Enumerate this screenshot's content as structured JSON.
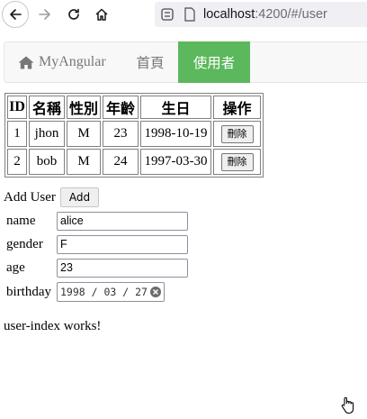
{
  "browser": {
    "url_host": "localhost",
    "url_rest": ":4200/#/user"
  },
  "navbar": {
    "brand": "MyAngular",
    "links": [
      {
        "label": "首頁",
        "active": false
      },
      {
        "label": "使用者",
        "active": true
      }
    ],
    "active_color": "#5cb85c"
  },
  "table": {
    "headers": [
      "ID",
      "名稱",
      "性別",
      "年齡",
      "生日",
      "操作"
    ],
    "rows": [
      {
        "id": "1",
        "name": "jhon",
        "gender": "M",
        "age": "23",
        "birthday": "1998-10-19",
        "action": "刪除"
      },
      {
        "id": "2",
        "name": "bob",
        "gender": "M",
        "age": "24",
        "birthday": "1997-03-30",
        "action": "刪除"
      }
    ]
  },
  "form": {
    "title": "Add User",
    "add_label": "Add",
    "fields": [
      {
        "label": "name",
        "value": "alice"
      },
      {
        "label": "gender",
        "value": "F"
      },
      {
        "label": "age",
        "value": "23"
      },
      {
        "label": "birthday",
        "value": "1998 / 03 / 27"
      }
    ]
  },
  "footer_text": "user-index works!"
}
